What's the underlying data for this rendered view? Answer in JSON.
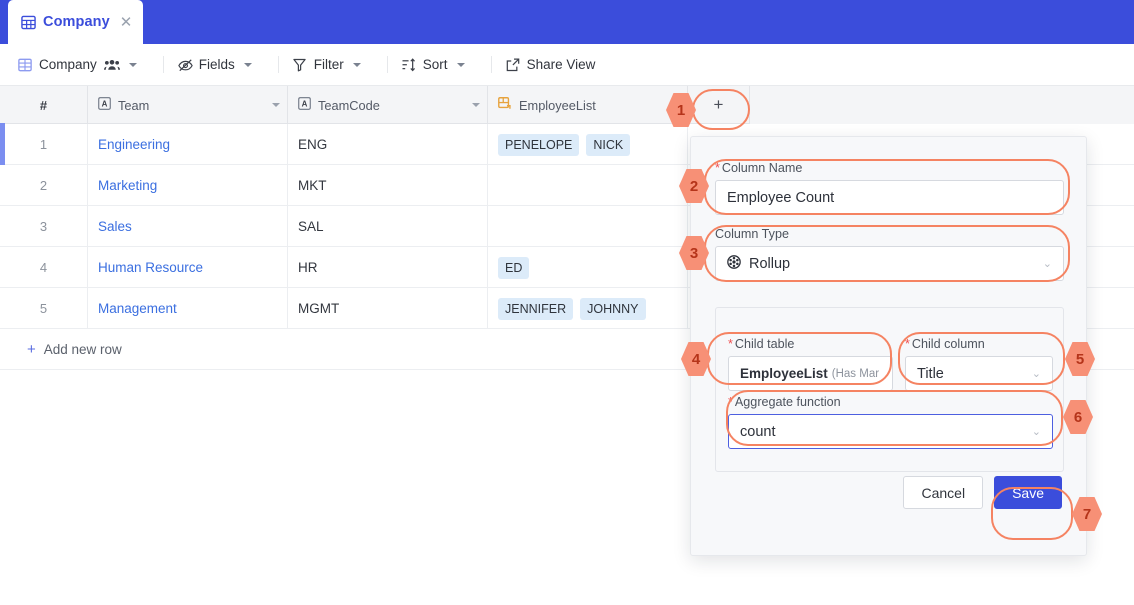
{
  "window": {
    "tab": {
      "label": "Company",
      "icon": "grid-icon",
      "close_icon": "close-icon"
    },
    "accent_blue": "#3b4ddb",
    "callout_color": "#f58362"
  },
  "toolbar": {
    "table_name": "Company",
    "items": [
      {
        "label": "Fields",
        "icon": "eye-off-icon"
      },
      {
        "label": "Filter",
        "icon": "filter-icon"
      },
      {
        "label": "Sort",
        "icon": "sort-icon"
      },
      {
        "label": "Share View",
        "icon": "share-icon"
      }
    ]
  },
  "grid": {
    "columns": [
      {
        "label": "#",
        "icon": "hash"
      },
      {
        "label": "Team",
        "icon": "text-field-icon"
      },
      {
        "label": "TeamCode",
        "icon": "text-field-icon"
      },
      {
        "label": "EmployeeList",
        "icon": "link-field-icon"
      }
    ],
    "add_column_label": "+",
    "rows": [
      {
        "n": "1",
        "team": "Engineering",
        "code": "ENG",
        "employees": [
          "PENELOPE",
          "NICK"
        ]
      },
      {
        "n": "2",
        "team": "Marketing",
        "code": "MKT",
        "employees": []
      },
      {
        "n": "3",
        "team": "Sales",
        "code": "SAL",
        "employees": []
      },
      {
        "n": "4",
        "team": "Human Resource",
        "code": "HR",
        "employees": [
          "ED"
        ]
      },
      {
        "n": "5",
        "team": "Management",
        "code": "MGMT",
        "employees": [
          "JENNIFER",
          "JOHNNY"
        ]
      }
    ],
    "add_row_label": "Add new row",
    "add_row_plus": "+"
  },
  "modal": {
    "column_name": {
      "label": "Column Name",
      "required": "*",
      "value": "Employee Count"
    },
    "column_type": {
      "label": "Column Type",
      "value": "Rollup",
      "icon": "rollup-icon",
      "chevron": "⌄"
    },
    "child_table": {
      "label": "Child table",
      "required": "*",
      "value": "EmployeeList",
      "suffix": "(Has Mar"
    },
    "child_column": {
      "label": "Child column",
      "required": "*",
      "value": "Title",
      "chevron": "⌄"
    },
    "aggregate_function": {
      "label": "Aggregate function",
      "required": "*",
      "value": "count",
      "chevron": "⌄"
    },
    "cancel_label": "Cancel",
    "save_label": "Save"
  },
  "callouts": [
    {
      "n": "1"
    },
    {
      "n": "2"
    },
    {
      "n": "3"
    },
    {
      "n": "4"
    },
    {
      "n": "5"
    },
    {
      "n": "6"
    },
    {
      "n": "7"
    }
  ]
}
